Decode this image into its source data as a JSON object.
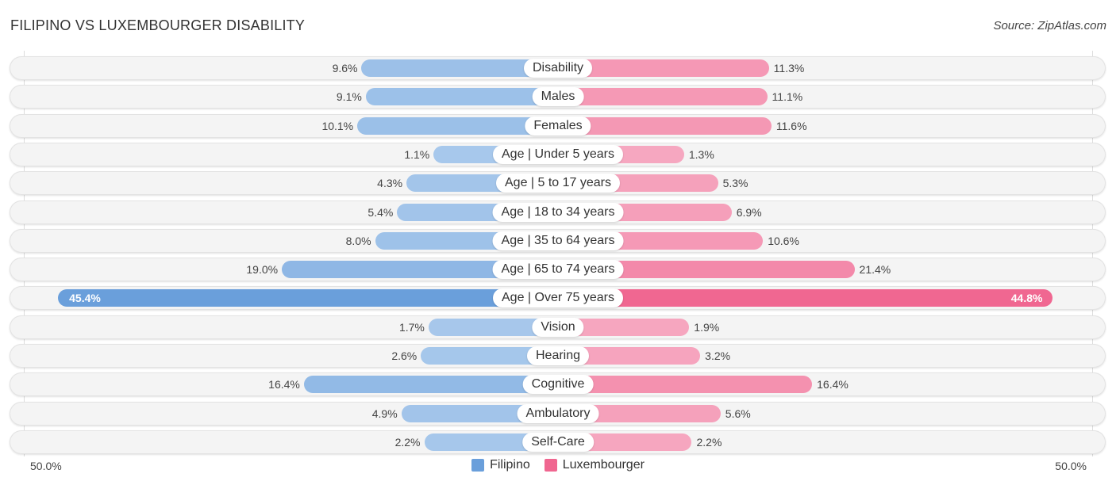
{
  "header": {
    "title": "FILIPINO VS LUXEMBOURGER DISABILITY",
    "source": "Source: ZipAtlas.com"
  },
  "colors": {
    "filipino": "#6a9fdb",
    "luxembourger": "#f06690",
    "filipino_light": "#a9c9ec",
    "luxembourger_light": "#f6a9c1"
  },
  "chart_data": {
    "type": "bar",
    "orientation": "horizontal-diverging",
    "title": "FILIPINO VS LUXEMBOURGER DISABILITY",
    "categories": [
      "Disability",
      "Males",
      "Females",
      "Age | Under 5 years",
      "Age | 5 to 17 years",
      "Age | 18 to 34 years",
      "Age | 35 to 64 years",
      "Age | 65 to 74 years",
      "Age | Over 75 years",
      "Vision",
      "Hearing",
      "Cognitive",
      "Ambulatory",
      "Self-Care"
    ],
    "series": [
      {
        "name": "Filipino",
        "values": [
          9.6,
          9.1,
          10.1,
          1.1,
          4.3,
          5.4,
          8.0,
          19.0,
          45.4,
          1.7,
          2.6,
          16.4,
          4.9,
          2.2
        ],
        "labels": [
          "9.6%",
          "9.1%",
          "10.1%",
          "1.1%",
          "4.3%",
          "5.4%",
          "8.0%",
          "19.0%",
          "45.4%",
          "1.7%",
          "2.6%",
          "16.4%",
          "4.9%",
          "2.2%"
        ]
      },
      {
        "name": "Luxembourger",
        "values": [
          11.3,
          11.1,
          11.6,
          1.3,
          5.3,
          6.9,
          10.6,
          21.4,
          44.8,
          1.9,
          3.2,
          16.4,
          5.6,
          2.2
        ],
        "labels": [
          "11.3%",
          "11.1%",
          "11.6%",
          "1.3%",
          "5.3%",
          "6.9%",
          "10.6%",
          "21.4%",
          "44.8%",
          "1.9%",
          "3.2%",
          "16.4%",
          "5.6%",
          "2.2%"
        ]
      }
    ],
    "axis": {
      "left_label": "50.0%",
      "right_label": "50.0%",
      "range": [
        0,
        50
      ]
    },
    "legend": {
      "position": "bottom-center",
      "items": [
        "Filipino",
        "Luxembourger"
      ]
    },
    "grid": false
  }
}
